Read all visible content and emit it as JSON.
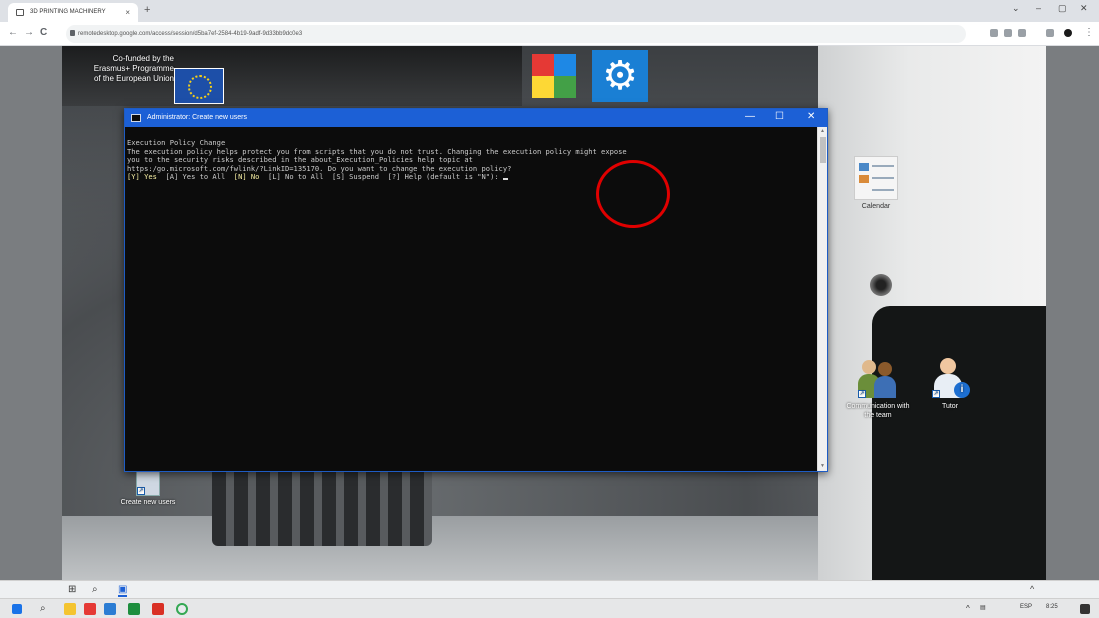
{
  "browser": {
    "tab_title": "3D PRINTING MACHINERY",
    "tab_close": "×",
    "new_tab": "+",
    "url": "remotedesktop.google.com/access/session/d5ba7ef-2584-4b19-9adf-9d33bb9dc0e3",
    "window_controls": [
      "⌄",
      "–",
      "▢",
      "✕"
    ],
    "nav": {
      "back": "←",
      "forward": "→",
      "reload": "C"
    }
  },
  "desktop": {
    "eu_text": "Co-funded by the\nErasmus+ Programme\nof the European Union",
    "gear_glyph": "⚙",
    "icons": [
      {
        "label": "Calendar"
      },
      {
        "label": "Communication with the team"
      },
      {
        "label": "Tutor"
      },
      {
        "label": "Create new users"
      }
    ]
  },
  "terminal": {
    "title": "Administrator: Create new users",
    "controls": [
      "—",
      "☐",
      "✕"
    ],
    "lines": [
      "Execution Policy Change",
      "The execution policy helps protect you from scripts that you do not trust. Changing the execution policy might expose",
      "you to the security risks described in the about_Execution_Policies help topic at",
      "https:/go.microsoft.com/fwlink/?LinkID=135170. Do you want to change the execution policy?"
    ],
    "prompt": {
      "yes": "[Y] Yes",
      "yes_all": "[A] Yes to All",
      "no": "[N] No",
      "no_all": "[L] No to All",
      "suspend": "[S] Suspend",
      "help": "[?] Help (default is \"N\"):"
    }
  },
  "remote_taskbar": {
    "chevron": "^"
  },
  "local_taskbar": {
    "tray_lang": "ESP",
    "tray_time": "8:25"
  }
}
